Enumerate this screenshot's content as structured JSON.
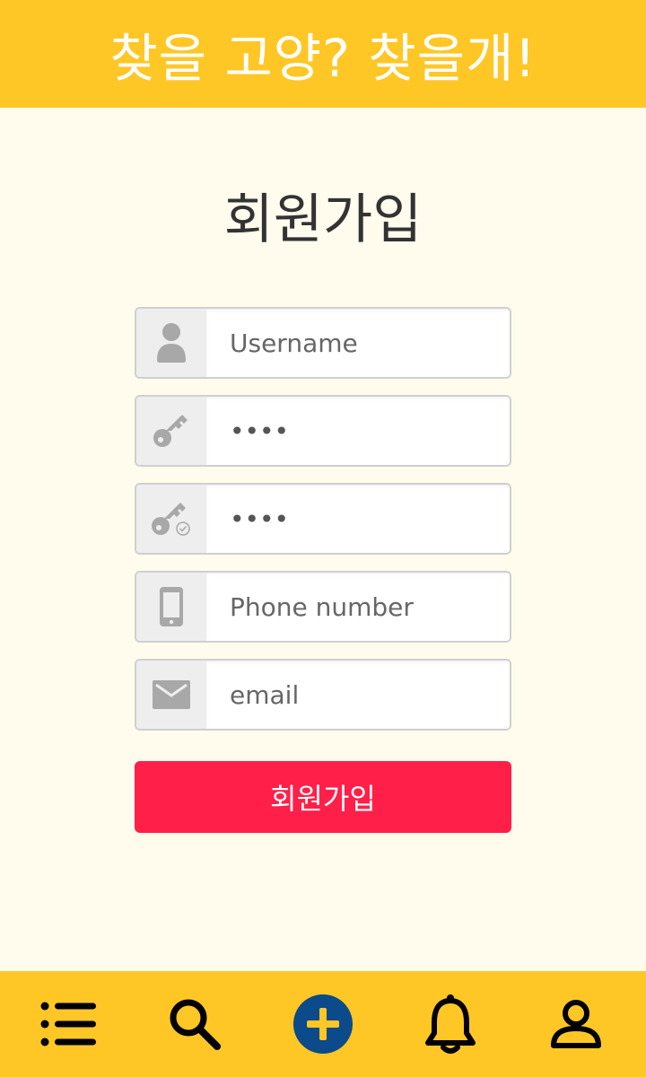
{
  "header": {
    "title": "찾을 고양? 찾을개!",
    "background_color": "#ffc726"
  },
  "page": {
    "title": "회원가입",
    "background_color": "#fffcee"
  },
  "form": {
    "fields": [
      {
        "icon": "user-icon",
        "placeholder": "Username",
        "value": ""
      },
      {
        "icon": "key-icon",
        "placeholder": "",
        "value": "••••"
      },
      {
        "icon": "key-check-icon",
        "placeholder": "",
        "value": "••••"
      },
      {
        "icon": "phone-icon",
        "placeholder": "Phone number",
        "value": ""
      },
      {
        "icon": "mail-icon",
        "placeholder": "email",
        "value": ""
      }
    ],
    "submit_label": "회원가입",
    "submit_color": "#ff1f48"
  },
  "bottom_nav": {
    "items": [
      {
        "icon": "list-icon"
      },
      {
        "icon": "search-icon"
      },
      {
        "icon": "add-icon",
        "color": "#0b4a8b"
      },
      {
        "icon": "bell-icon"
      },
      {
        "icon": "profile-icon"
      }
    ]
  }
}
